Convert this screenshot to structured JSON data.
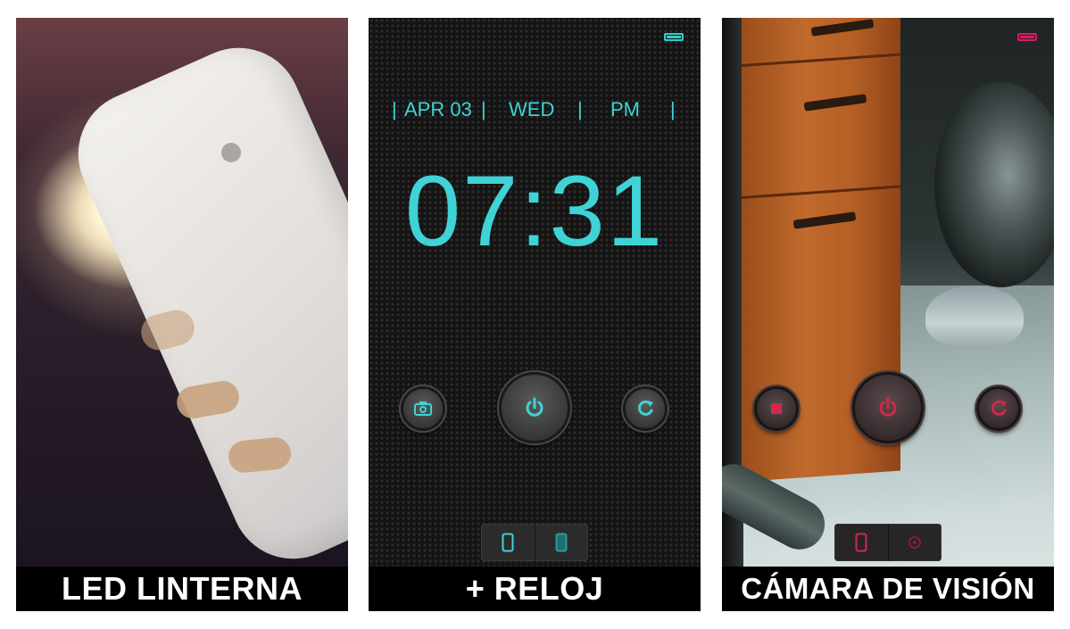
{
  "panels": [
    {
      "caption": "LED LINTERNA"
    },
    {
      "caption": "+ RELOJ"
    },
    {
      "caption": "CÁMARA DE VISIÓN"
    }
  ],
  "clock": {
    "date": "APR 03",
    "day": "WED",
    "ampm": "PM",
    "separator": "|",
    "time": "07:31",
    "accent_color": "#3fd3d6",
    "battery_color": "#2fcfc6"
  },
  "camera": {
    "accent_color": "#d2284a",
    "battery_color": "#d81b60"
  },
  "icons": {
    "clock_left": "camera-switch-icon",
    "clock_center": "power-icon",
    "clock_right": "refresh-icon",
    "clock_seg_left": "phone-outline-icon",
    "clock_seg_right": "phone-filled-icon",
    "cam_left": "square-icon",
    "cam_center": "power-icon",
    "cam_right": "refresh-icon",
    "cam_seg_left": "phone-outline-icon",
    "cam_seg_right": "target-icon"
  }
}
